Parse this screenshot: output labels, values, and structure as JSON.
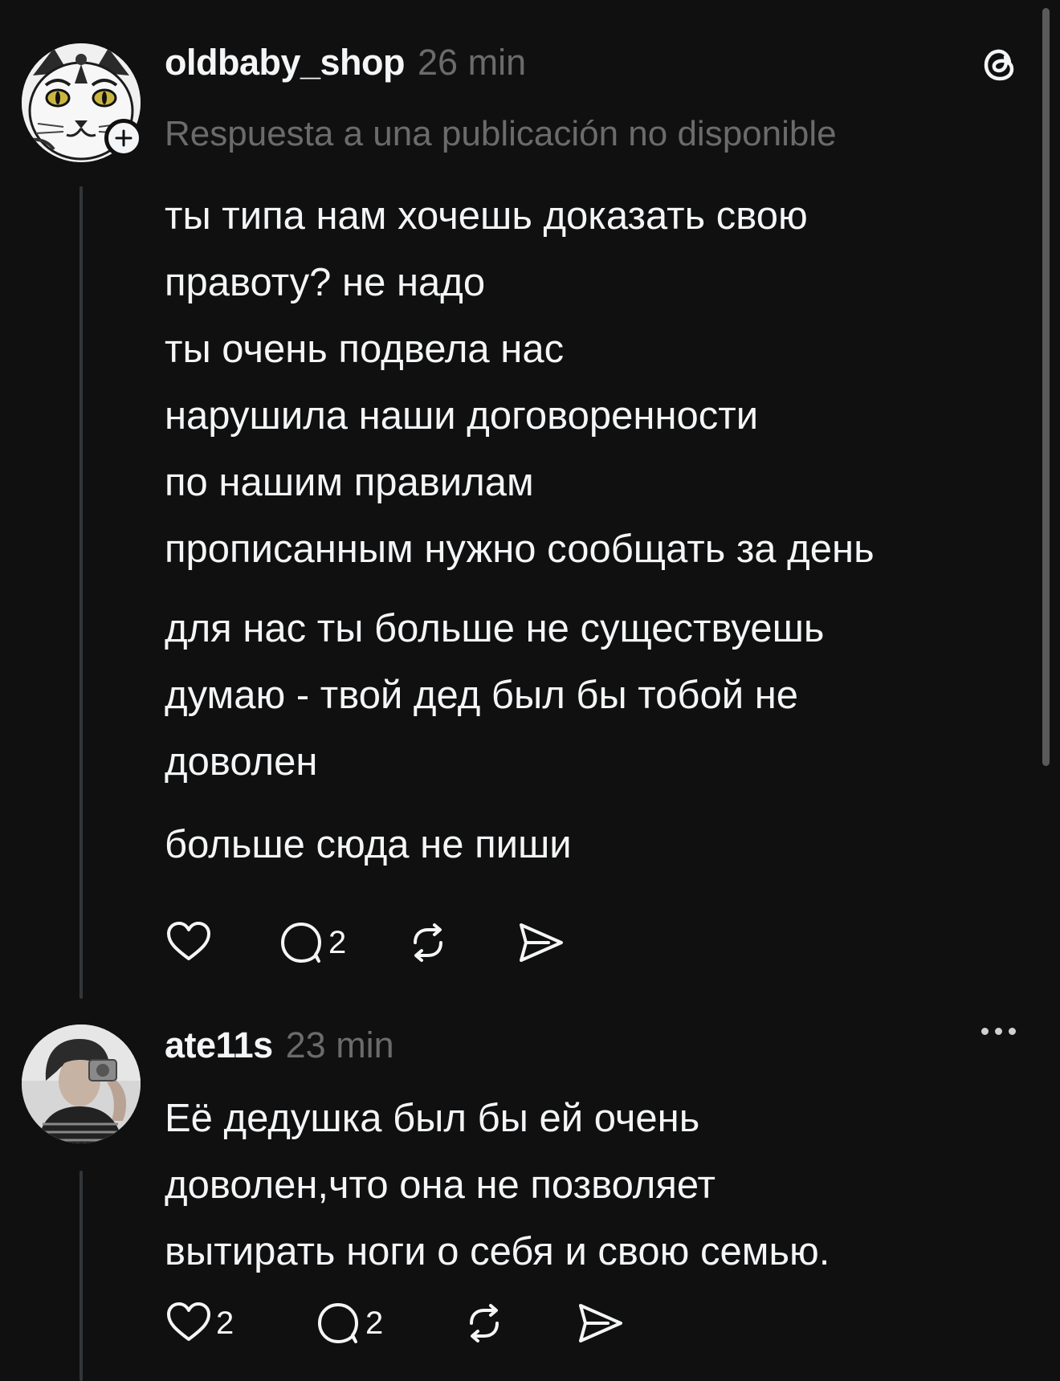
{
  "posts": [
    {
      "username": "oldbaby_shop",
      "time": "26 min",
      "reply_note": "Respuesta a una publicación no disponible",
      "paragraphs": [
        "ты типа нам хочешь доказать свою\nправоту? не надо\nты очень подвела нас\nнарушила наши договоренности\nпо нашим правилам\nпрописанным нужно сообщать за день",
        "для нас ты больше не существуешь\nдумаю - твой дед был бы тобой  не\nдоволен",
        "больше сюда не пиши"
      ],
      "likes": "",
      "replies": "2",
      "avatar_icon": "cat-avatar-icon"
    },
    {
      "username": "ate11s",
      "time": "23 min",
      "paragraphs": [
        "Её дедушка был бы ей очень\nдоволен,что она не позволяет\nвытирать ноги о себя и свою семью."
      ],
      "likes": "2",
      "replies": "2",
      "avatar_icon": "person-avatar-icon"
    }
  ],
  "icons": {
    "like": "heart-icon",
    "reply": "comment-icon",
    "repost": "repost-icon",
    "share": "send-icon",
    "app": "threads-logo-icon",
    "more": "more-icon",
    "follow": "plus-icon"
  },
  "colors": {
    "background": "#101010",
    "text": "#f3f5f7",
    "muted": "#6b6b6b",
    "thread_line": "#333638"
  }
}
